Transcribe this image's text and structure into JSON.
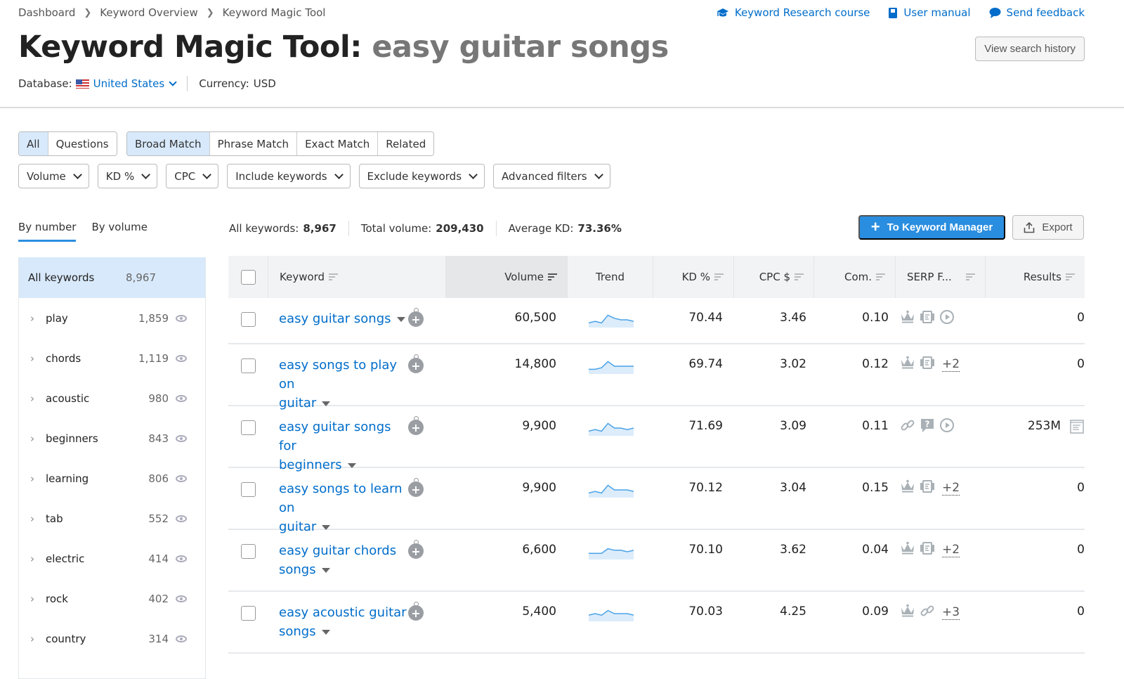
{
  "breadcrumb": [
    "Dashboard",
    "Keyword Overview",
    "Keyword Magic Tool"
  ],
  "top_links": [
    {
      "label": "Keyword Research course",
      "icon": "graduation-cap-icon"
    },
    {
      "label": "User manual",
      "icon": "book-icon"
    },
    {
      "label": "Send feedback",
      "icon": "speech-bubble-icon"
    }
  ],
  "title": {
    "tool": "Keyword Magic Tool:",
    "query": "easy guitar songs"
  },
  "history_button": "View search history",
  "database": {
    "label": "Database:",
    "value": "United States",
    "currency_label": "Currency:",
    "currency": "USD"
  },
  "segments_type": [
    {
      "label": "All",
      "active": true
    },
    {
      "label": "Questions",
      "active": false
    }
  ],
  "segments_match": [
    {
      "label": "Broad Match",
      "active": true
    },
    {
      "label": "Phrase Match",
      "active": false
    },
    {
      "label": "Exact Match",
      "active": false
    },
    {
      "label": "Related",
      "active": false
    }
  ],
  "filters": [
    "Volume",
    "KD %",
    "CPC",
    "Include keywords",
    "Exclude keywords",
    "Advanced filters"
  ],
  "group_tabs": [
    {
      "label": "By number",
      "active": true
    },
    {
      "label": "By volume",
      "active": false
    }
  ],
  "stats": {
    "all_keywords_label": "All keywords:",
    "all_keywords": "8,967",
    "total_volume_label": "Total volume:",
    "total_volume": "209,430",
    "avg_kd_label": "Average KD:",
    "avg_kd": "73.36%"
  },
  "actions": {
    "keyword_manager": "To Keyword Manager",
    "export": "Export"
  },
  "sidebar": {
    "all": {
      "label": "All keywords",
      "count": "8,967"
    },
    "groups": [
      {
        "label": "play",
        "count": "1,859"
      },
      {
        "label": "chords",
        "count": "1,119"
      },
      {
        "label": "acoustic",
        "count": "980"
      },
      {
        "label": "beginners",
        "count": "843"
      },
      {
        "label": "learning",
        "count": "806"
      },
      {
        "label": "tab",
        "count": "552"
      },
      {
        "label": "electric",
        "count": "414"
      },
      {
        "label": "rock",
        "count": "402"
      },
      {
        "label": "country",
        "count": "314"
      }
    ]
  },
  "table": {
    "columns": [
      "Keyword",
      "Volume",
      "Trend",
      "KD %",
      "CPC $",
      "Com.",
      "SERP F...",
      "Results"
    ],
    "rows": [
      {
        "keyword_1": "easy guitar songs",
        "keyword_2": "",
        "volume": "60,500",
        "trend": [
          3,
          4,
          3,
          8,
          6,
          5,
          5,
          4
        ],
        "kd": "70.44",
        "cpc": "3.46",
        "com": "0.10",
        "serp": [
          "crown-icon",
          "news-icon",
          "video-icon"
        ],
        "serp_more": "",
        "results": "0"
      },
      {
        "keyword_1": "easy songs to play on",
        "keyword_2": "guitar",
        "volume": "14,800",
        "trend": [
          3,
          3,
          4,
          8,
          5,
          5,
          5,
          5
        ],
        "kd": "69.74",
        "cpc": "3.02",
        "com": "0.12",
        "serp": [
          "crown-icon",
          "news-icon"
        ],
        "serp_more": "+2",
        "results": "0"
      },
      {
        "keyword_1": "easy guitar songs for",
        "keyword_2": "beginners",
        "volume": "9,900",
        "trend": [
          3,
          4,
          3,
          8,
          5,
          5,
          4,
          5
        ],
        "kd": "71.69",
        "cpc": "3.09",
        "com": "0.11",
        "serp": [
          "link-icon",
          "question-icon",
          "video-icon"
        ],
        "serp_more": "",
        "results": "253M"
      },
      {
        "keyword_1": "easy songs to learn on",
        "keyword_2": "guitar",
        "volume": "9,900",
        "trend": [
          3,
          4,
          3,
          8,
          5,
          5,
          5,
          4
        ],
        "kd": "70.12",
        "cpc": "3.04",
        "com": "0.15",
        "serp": [
          "crown-icon",
          "news-icon"
        ],
        "serp_more": "+2",
        "results": "0"
      },
      {
        "keyword_1": "easy guitar chords",
        "keyword_2": "songs",
        "volume": "6,600",
        "trend": [
          4,
          4,
          4,
          7,
          6,
          6,
          5,
          6
        ],
        "kd": "70.10",
        "cpc": "3.62",
        "com": "0.04",
        "serp": [
          "crown-icon",
          "news-icon"
        ],
        "serp_more": "+2",
        "results": "0"
      },
      {
        "keyword_1": "easy acoustic guitar",
        "keyword_2": "songs",
        "volume": "5,400",
        "trend": [
          4,
          5,
          4,
          7,
          5,
          5,
          5,
          4
        ],
        "kd": "70.03",
        "cpc": "4.25",
        "com": "0.09",
        "serp": [
          "crown-icon",
          "link-icon"
        ],
        "serp_more": "+3",
        "results": "0"
      }
    ]
  },
  "colors": {
    "accent": "#2a8ee0",
    "link": "#006dca",
    "active_bg": "#d8e9fb",
    "trend_line": "#4aa3e8",
    "trend_fill": "#dcecfb"
  }
}
